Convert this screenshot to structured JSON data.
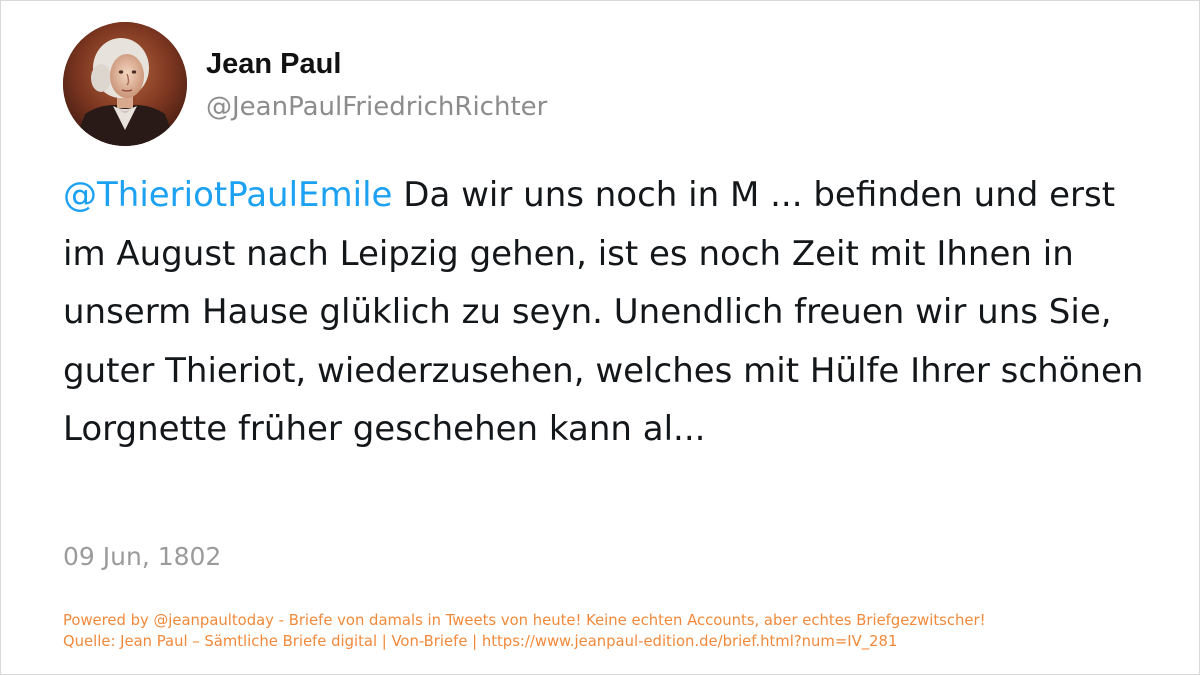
{
  "profile": {
    "display_name": "Jean Paul",
    "handle": "@JeanPaulFriedrichRichter",
    "avatar_icon": "portrait-avatar"
  },
  "tweet": {
    "mention": "@ThieriotPaulEmile",
    "body": " Da wir uns noch in M ... befinden und erst im August nach Leipzig gehen, ist es noch Zeit mit Ihnen in unserm Hause glüklich zu seyn. Unendlich freuen wir uns Sie, guter Thieriot, wiederzusehen, welches mit Hülfe Ihrer schönen Lorgnette früher geschehen kann al...",
    "date": "09 Jun, 1802"
  },
  "footer": {
    "powered_by": "Powered by @jeanpaultoday - Briefe von damals in Tweets von heute! Keine echten Accounts, aber echtes Briefgezwitscher!",
    "source": "Quelle: Jean Paul – Sämtliche Briefe digital | Von-Briefe | https://www.jeanpaul-edition.de/brief.html?num=IV_281"
  },
  "colors": {
    "mention": "#1da1f2",
    "footer": "#f2893a",
    "text": "#14171a",
    "muted": "#8c8c8c"
  }
}
